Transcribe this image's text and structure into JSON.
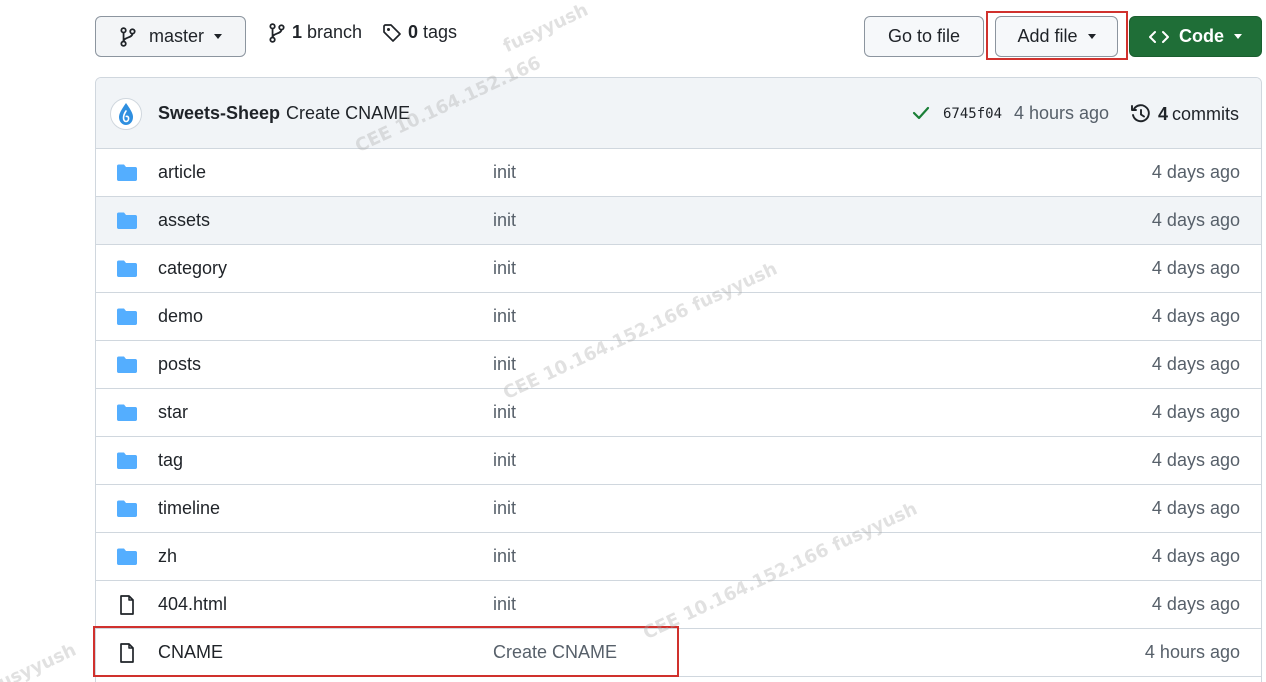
{
  "toolbar": {
    "branch_label": "master",
    "branch_count": "1",
    "branch_word": "branch",
    "tag_count": "0",
    "tag_word": "tags",
    "goto_label": "Go to file",
    "add_file_label": "Add file",
    "code_label": "Code"
  },
  "commit": {
    "author": "Sweets-Sheep",
    "message": "Create CNAME",
    "sha": "6745f04",
    "time": "4 hours ago",
    "commits_count": "4",
    "commits_word": "commits"
  },
  "files": [
    {
      "name": "article",
      "type": "folder",
      "message": "init",
      "time": "4 days ago"
    },
    {
      "name": "assets",
      "type": "folder",
      "message": "init",
      "time": "4 days ago"
    },
    {
      "name": "category",
      "type": "folder",
      "message": "init",
      "time": "4 days ago"
    },
    {
      "name": "demo",
      "type": "folder",
      "message": "init",
      "time": "4 days ago"
    },
    {
      "name": "posts",
      "type": "folder",
      "message": "init",
      "time": "4 days ago"
    },
    {
      "name": "star",
      "type": "folder",
      "message": "init",
      "time": "4 days ago"
    },
    {
      "name": "tag",
      "type": "folder",
      "message": "init",
      "time": "4 days ago"
    },
    {
      "name": "timeline",
      "type": "folder",
      "message": "init",
      "time": "4 days ago"
    },
    {
      "name": "zh",
      "type": "folder",
      "message": "init",
      "time": "4 days ago"
    },
    {
      "name": "404.html",
      "type": "file",
      "message": "init",
      "time": "4 days ago"
    },
    {
      "name": "CNAME",
      "type": "file",
      "message": "Create CNAME",
      "time": "4 hours ago"
    }
  ],
  "watermarks": {
    "text_a": "fusyyush",
    "text_b": "CEE 10.164.152.166",
    "text_c": "CEE 10.164.152.166 fusyyush"
  },
  "colors": {
    "code_button": "#1f6e37",
    "folder_icon": "#54aeff",
    "highlight_box": "#d0312d",
    "check_icon": "#1a7f37"
  }
}
